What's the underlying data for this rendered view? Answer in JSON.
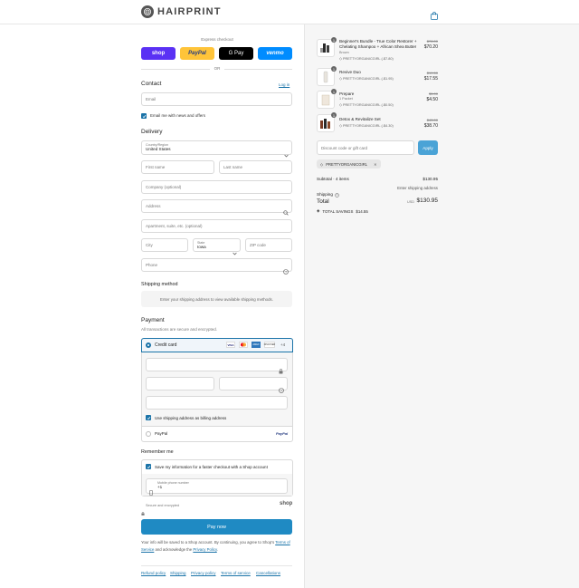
{
  "brand": {
    "name": "HAIRPRINT"
  },
  "express": {
    "title": "Express checkout",
    "or": "OR",
    "buttons": [
      {
        "label": "shop",
        "color": "#5a31f4"
      },
      {
        "label": "PayPal",
        "color": "#ffc439"
      },
      {
        "label": "G Pay",
        "color": "#000000"
      },
      {
        "label": "venmo",
        "color": "#008cff"
      }
    ]
  },
  "contact": {
    "title": "Contact",
    "login": "Log in",
    "email_placeholder": "Email",
    "news_label": "Email me with news and offers"
  },
  "delivery": {
    "title": "Delivery",
    "country_label": "Country/Region",
    "country_value": "United States",
    "first_name": "First name",
    "last_name": "Last name",
    "company": "Company (optional)",
    "address": "Address",
    "apartment": "Apartment, suite, etc. (optional)",
    "city": "City",
    "state_label": "State",
    "state_value": "Iowa",
    "zip": "ZIP code",
    "phone": "Phone"
  },
  "shipping": {
    "title": "Shipping method",
    "note": "Enter your shipping address to view available shipping methods."
  },
  "payment": {
    "title": "Payment",
    "subtitle": "All transactions are secure and encrypted.",
    "credit_card": "Credit card",
    "more_cards": "+4",
    "billing_label": "Use shipping address as billing address",
    "paypal": "PayPal",
    "paypal_logo": "PayPal"
  },
  "remember": {
    "title": "Remember me",
    "save_label": "Save my information for a faster checkout with a Shop account",
    "mobile_label": "Mobile phone number",
    "mobile_value": "+1",
    "secure": "Secure and encrypted",
    "shop": "shop"
  },
  "cta": {
    "pay_now": "Pay now",
    "disclaimer_1": "Your info will be saved to a Shop account. By continuing, you agree to Shop's",
    "terms": "Terms of Service",
    "disclaimer_2": " and acknowledge the ",
    "privacy": "Privacy Policy",
    "disclaimer_3": "."
  },
  "footer_links": [
    "Refund policy",
    "Shipping",
    "Privacy policy",
    "Terms of service",
    "Cancellations"
  ],
  "order": {
    "items": [
      {
        "qty": "1",
        "name": "Beginner's Bundle - True Color Restorer + Chelating Shampoo + African Shea Butter",
        "variant": "Brown",
        "code": "PRETTYORGANICGIRL (-$7.80)",
        "old": "$78.00",
        "price": "$70.20"
      },
      {
        "qty": "1",
        "name": "Revive Duo",
        "variant": "",
        "code": "PRETTYORGANICGIRL (-$1.95)",
        "old": "$19.50",
        "price": "$17.55"
      },
      {
        "qty": "1",
        "name": "Prepare",
        "variant": "1 Packet",
        "code": "PRETTYORGANICGIRL (-$0.50)",
        "old": "$5.00",
        "price": "$4.50"
      },
      {
        "qty": "1",
        "name": "Detox & Revitalize Set",
        "variant": "",
        "code": "PRETTYORGANICGIRL (-$4.30)",
        "old": "$43.00",
        "price": "$38.70"
      }
    ],
    "discount_placeholder": "Discount code or gift card",
    "apply": "Apply",
    "applied_code": "PRETTYORGANICGIRL",
    "subtotal_label": "Subtotal · 4 items",
    "subtotal_value": "$130.95",
    "shipping_label": "Shipping",
    "shipping_value": "Enter shipping address",
    "total_label": "Total",
    "currency": "USD",
    "total_value": "$130.95",
    "savings_label": "TOTAL SAVINGS",
    "savings_value": "$14.55"
  }
}
